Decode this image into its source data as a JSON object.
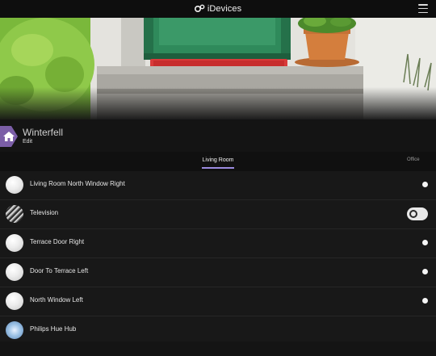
{
  "app": {
    "brand": "iDevices"
  },
  "profile": {
    "name": "Winterfell",
    "edit_label": "Edit"
  },
  "tabs": [
    {
      "label": "Living Room",
      "active": true
    },
    {
      "label": "Office",
      "active": false
    }
  ],
  "devices": [
    {
      "name": "Living Room North Window Right",
      "icon": "light-bulb-icon",
      "control": "status-dot"
    },
    {
      "name": "Television",
      "icon": "television-icon",
      "control": "power-toggle"
    },
    {
      "name": "Terrace Door Right",
      "icon": "light-bulb-icon",
      "control": "status-dot"
    },
    {
      "name": "Door To Terrace Left",
      "icon": "light-bulb-icon",
      "control": "status-dot"
    },
    {
      "name": "North Window Left",
      "icon": "light-bulb-icon",
      "control": "status-dot"
    },
    {
      "name": "Philips Hue Hub",
      "icon": "hue-hub-icon",
      "control": "none"
    }
  ],
  "colors": {
    "accent": "#9b8be0",
    "home_badge": "#7b5ea7",
    "background": "#151515"
  }
}
